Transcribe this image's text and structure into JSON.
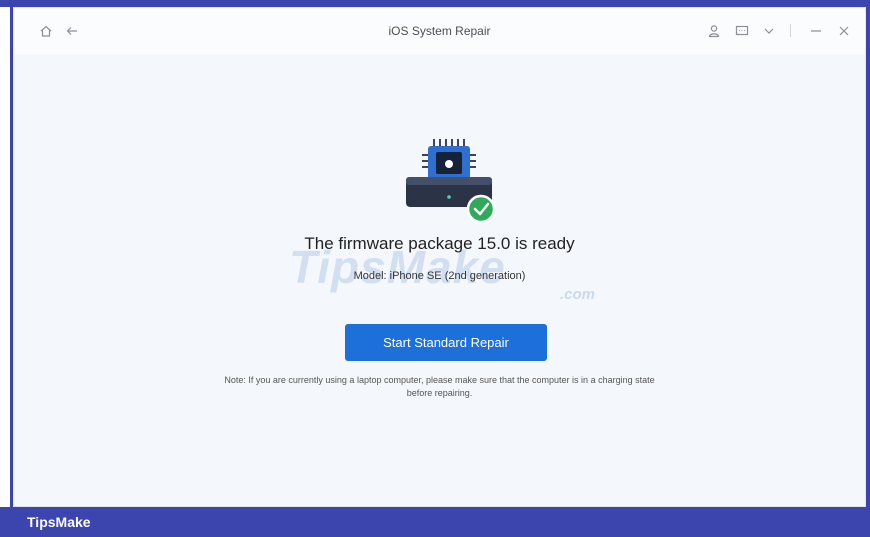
{
  "window": {
    "title": "iOS System Repair",
    "icons": [
      "home-icon",
      "back-arrow-icon",
      "user-icon",
      "feedback-icon",
      "chevron-down-icon",
      "minimize-icon",
      "close-icon"
    ]
  },
  "main": {
    "headline": "The firmware package 15.0 is ready",
    "model_text": "Model: iPhone SE (2nd generation)",
    "repair_button_label": "Start Standard Repair",
    "note_text": "Note:   If you are currently using a laptop computer, please make sure that the computer is in a charging state before repairing."
  },
  "watermark": {
    "text": "TipsMake",
    "suffix": ".com"
  },
  "footer": {
    "brand": "TipsMake"
  },
  "colors": {
    "accent": "#1d6fd9",
    "frame": "#3b45ad",
    "success": "#2eaa5a",
    "background": "#f4f7fb"
  }
}
